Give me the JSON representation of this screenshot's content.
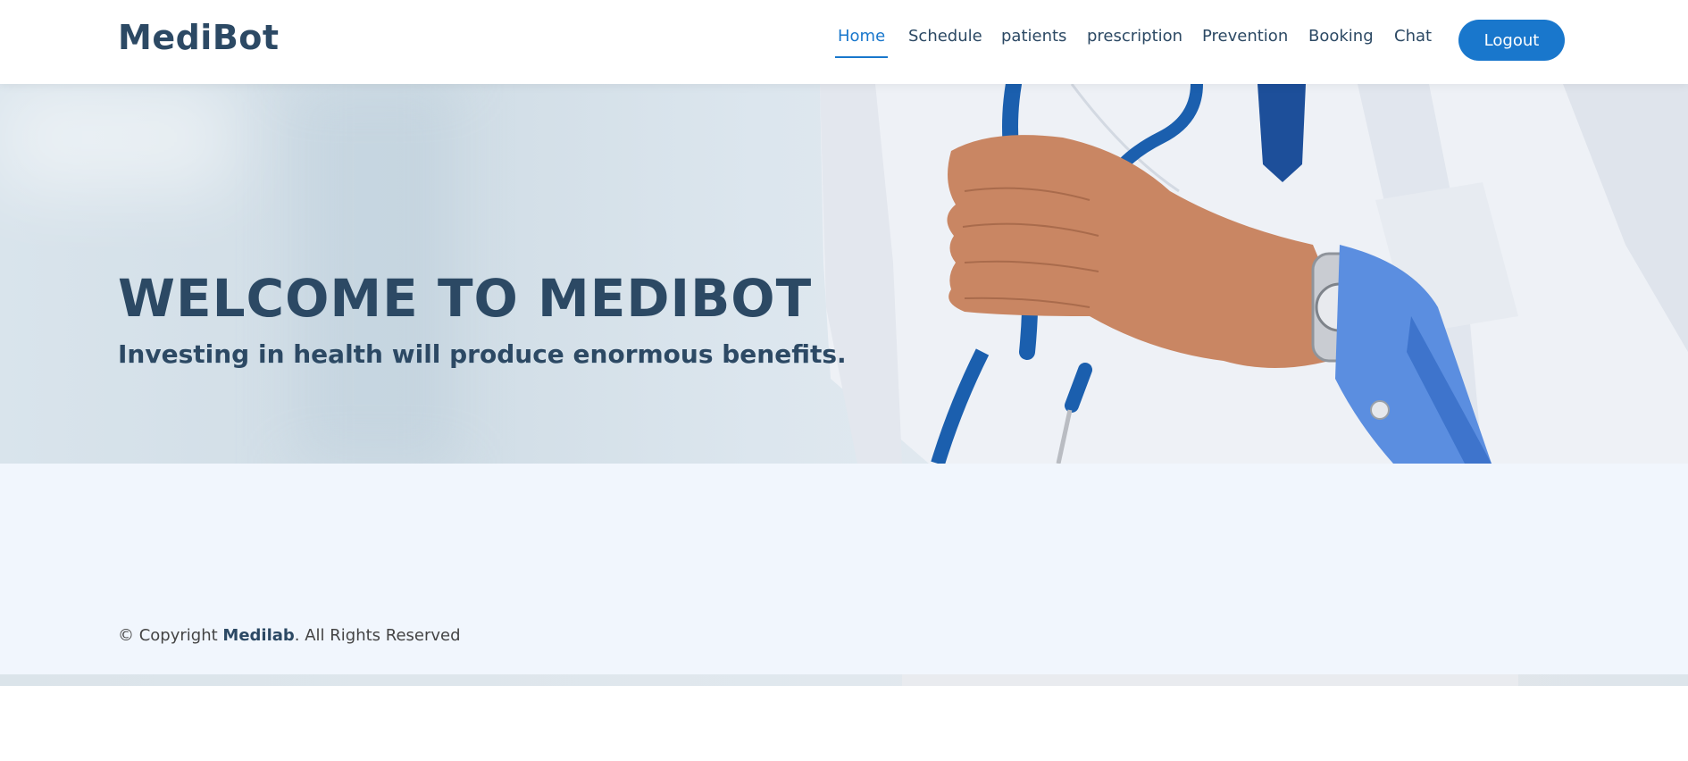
{
  "header": {
    "logo": "MediBot",
    "nav": [
      {
        "label": "Home",
        "active": true
      },
      {
        "label": "Schedule",
        "active": false
      },
      {
        "label": "patients",
        "active": false
      },
      {
        "label": "prescription",
        "active": false
      },
      {
        "label": "Prevention",
        "active": false
      },
      {
        "label": "Booking",
        "active": false
      },
      {
        "label": "Chat",
        "active": false
      }
    ],
    "logout_label": "Logout"
  },
  "hero": {
    "title": "WELCOME TO MEDIBOT",
    "subtitle": "Investing in health will produce enormous benefits."
  },
  "footer": {
    "copyright_prefix": "© Copyright ",
    "brand": "Medilab",
    "copyright_suffix": ". All Rights Reserved"
  },
  "colors": {
    "accent": "#1977cc",
    "heading": "#2c4964",
    "footer_bg": "#f1f6fd"
  }
}
